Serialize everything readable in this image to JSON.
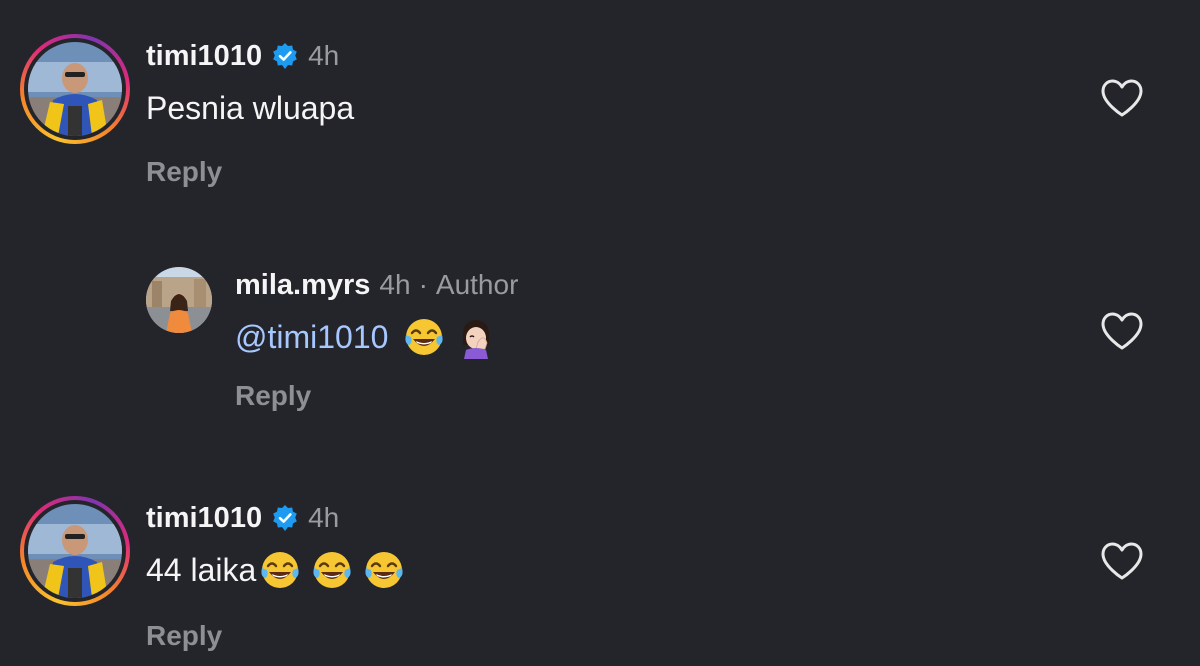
{
  "comments": [
    {
      "username": "timi1010",
      "time": "4h",
      "text": "Pesnia wluapa",
      "reply_label": "Reply"
    },
    {
      "username": "mila.myrs",
      "time": "4h",
      "separator": "·",
      "author_tag": "Author",
      "mention": "@timi1010",
      "emojis": [
        "tears-of-joy-emoji",
        "face-palm-emoji"
      ],
      "reply_label": "Reply"
    },
    {
      "username": "timi1010",
      "time": "4h",
      "text": "44 laika",
      "emojis": [
        "tears-of-joy-emoji",
        "tears-of-joy-emoji",
        "tears-of-joy-emoji"
      ],
      "reply_label": "Reply"
    }
  ],
  "colors": {
    "background": "#24252b",
    "verified": "#1d9bf0",
    "mention": "#a6c8ff",
    "muted": "#9a9ba0"
  }
}
